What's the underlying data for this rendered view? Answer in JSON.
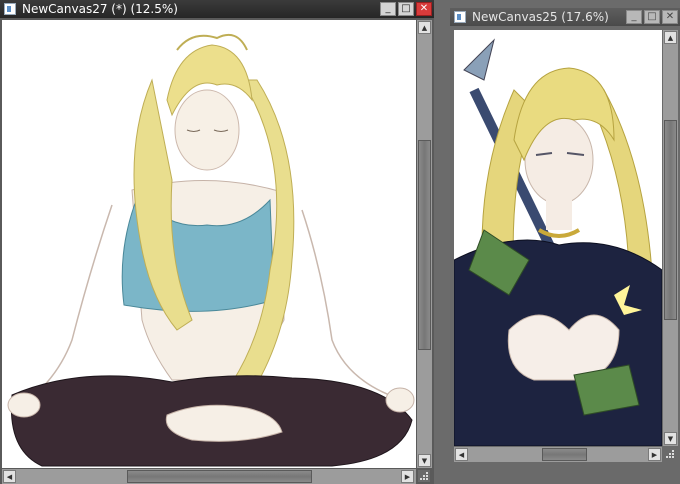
{
  "windows": [
    {
      "title": "NewCanvas27 (*) (12.5%)",
      "active": true,
      "buttons": {
        "minimize": "_",
        "maximize": "□",
        "close": "✕"
      }
    },
    {
      "title": "NewCanvas25 (17.6%)",
      "active": false,
      "buttons": {
        "minimize": "_",
        "maximize": "□",
        "close": "✕"
      }
    }
  ],
  "scroll_arrows": {
    "up": "▲",
    "down": "▼",
    "left": "◀",
    "right": "▶"
  },
  "colors": {
    "active_close": "#d83b3b",
    "hair": "#e9de8e",
    "tank_top": "#7bb6c8",
    "pants": "#3a2a33",
    "armor": "#1d2340",
    "skin": "#f6efe6"
  },
  "icons": [
    "app-icon",
    "minimize-icon",
    "maximize-icon",
    "close-icon",
    "resize-grip-icon"
  ]
}
